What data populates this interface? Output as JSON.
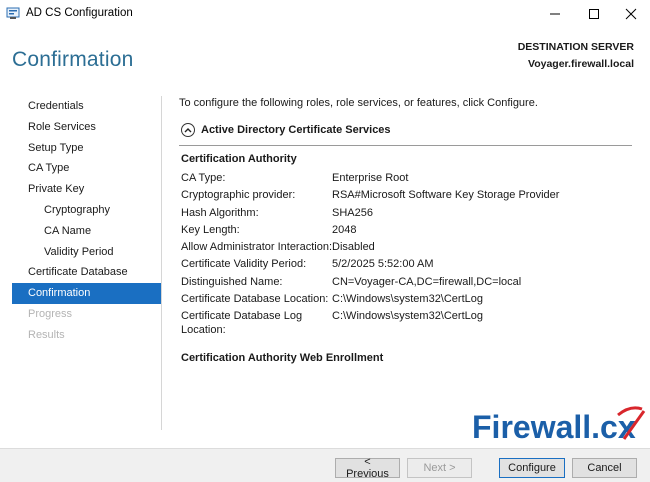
{
  "window": {
    "title": "AD CS Configuration"
  },
  "header": {
    "page_title": "Confirmation",
    "destination_label": "DESTINATION SERVER",
    "destination_server": "Voyager.firewall.local"
  },
  "nav": {
    "items": [
      {
        "label": "Credentials",
        "state": "normal",
        "level": 0
      },
      {
        "label": "Role Services",
        "state": "normal",
        "level": 0
      },
      {
        "label": "Setup Type",
        "state": "normal",
        "level": 0
      },
      {
        "label": "CA Type",
        "state": "normal",
        "level": 0
      },
      {
        "label": "Private Key",
        "state": "normal",
        "level": 0
      },
      {
        "label": "Cryptography",
        "state": "normal",
        "level": 1
      },
      {
        "label": "CA Name",
        "state": "normal",
        "level": 1
      },
      {
        "label": "Validity Period",
        "state": "normal",
        "level": 1
      },
      {
        "label": "Certificate Database",
        "state": "normal",
        "level": 0
      },
      {
        "label": "Confirmation",
        "state": "active",
        "level": 0
      },
      {
        "label": "Progress",
        "state": "disabled",
        "level": 0
      },
      {
        "label": "Results",
        "state": "disabled",
        "level": 0
      }
    ]
  },
  "main": {
    "intro": "To configure the following roles, role services, or features, click Configure.",
    "section_title": "Active Directory Certificate Services",
    "ca_group_title": "Certification Authority",
    "ca_details": [
      {
        "key": "CA Type:",
        "value": "Enterprise Root"
      },
      {
        "key": "Cryptographic provider:",
        "value": "RSA#Microsoft Software Key Storage Provider"
      },
      {
        "key": "Hash Algorithm:",
        "value": "SHA256"
      },
      {
        "key": "Key Length:",
        "value": "2048"
      },
      {
        "key": "Allow Administrator Interaction:",
        "value": "Disabled"
      },
      {
        "key": "Certificate Validity Period:",
        "value": "5/2/2025 5:52:00 AM"
      },
      {
        "key": "Distinguished Name:",
        "value": "CN=Voyager-CA,DC=firewall,DC=local"
      },
      {
        "key": "Certificate Database Location:",
        "value": "C:\\Windows\\system32\\CertLog"
      },
      {
        "key": "Certificate Database Log Location:",
        "value": "C:\\Windows\\system32\\CertLog"
      }
    ],
    "web_enrollment_title": "Certification Authority Web Enrollment"
  },
  "footer": {
    "previous_label": "< Previous",
    "next_label": "Next >",
    "configure_label": "Configure",
    "cancel_label": "Cancel"
  },
  "watermark": {
    "text": "Firewall.cx"
  },
  "colors": {
    "accent": "#1a6fc2",
    "title_blue": "#2c6e94",
    "logo_blue": "#1b5fa8",
    "logo_red": "#d8262c"
  }
}
